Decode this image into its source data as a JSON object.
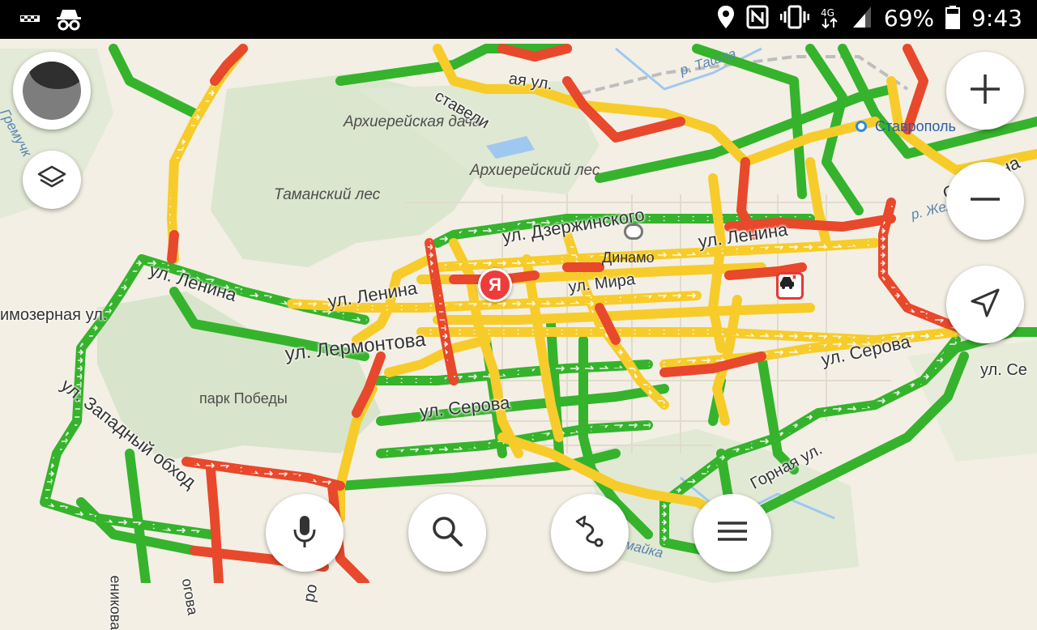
{
  "status_bar": {
    "battery": "69%",
    "time": "9:43",
    "icons": [
      "taxi-icon",
      "incognito-icon",
      "location-icon",
      "nfc-icon",
      "vibrate-icon",
      "data-4g-icon",
      "signal-icon",
      "battery-icon"
    ]
  },
  "map": {
    "area_labels": {
      "arkh_dacha": "Архиерейская дача",
      "arkh_les": "Архиерейский лес",
      "taman_les": "Таманский лес",
      "park": "парк Победы",
      "dinamo": "Динамо"
    },
    "streets": {
      "dzerzhinskogo": "ул. Дзержинского",
      "lenina_w": "ул. Ленина",
      "lenina_c": "ул. Ленина",
      "lenina_e": "ул. Ленина",
      "mira": "ул. Мира",
      "lermontova": "ул. Лермонтова",
      "serova_c": "ул. Серова",
      "serova_e": "ул. Серова",
      "zapadny": "ул. Западный обход",
      "ozernaya": "имозерная ул.",
      "gornaya": "Горная ул.",
      "obyezdnaya": "Объездна",
      "stavely": "ставели",
      "top_ul": "ая ул.",
      "se_edge": "ул. Се",
      "vertical_left": "еникова",
      "vertical_right": "огова",
      "bottom_edge": "ро"
    },
    "rivers": {
      "tashla": "р. Ташла",
      "zhelobovka": "р. Желобовка",
      "gremuch": "Гремучк",
      "bottom": "р. Мамайка"
    },
    "city": "Ставрополь",
    "user_marker": "Я",
    "traffic_colors": {
      "free": "#35b32c",
      "medium": "#f7cc2a",
      "heavy": "#e8482c"
    }
  },
  "controls": {
    "profile": "avatar",
    "layers": "layers-icon",
    "zoom_in": "plus-icon",
    "zoom_out": "minus-icon",
    "locate": "navigation-arrow-icon",
    "voice": "microphone-icon",
    "search": "search-icon",
    "routes": "route-icon",
    "menu": "menu-icon"
  }
}
